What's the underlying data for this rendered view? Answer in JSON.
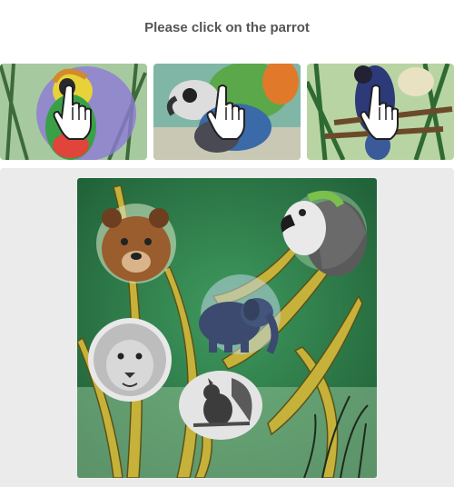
{
  "prompt": {
    "text": "Please click on the parrot"
  },
  "thumbnails": [
    {
      "name": "parrot-thumbnail-1",
      "icon": "hand-pointer-icon"
    },
    {
      "name": "parrot-thumbnail-2",
      "icon": "hand-pointer-icon"
    },
    {
      "name": "parrot-thumbnail-3",
      "icon": "hand-pointer-icon"
    }
  ],
  "scene": {
    "animals": [
      "bear",
      "parrot",
      "elephant",
      "lion",
      "squirrel"
    ]
  },
  "colors": {
    "prompt_text": "#555555",
    "panel_bg": "#ebebeb",
    "scene_green": "#2f7d4a"
  }
}
